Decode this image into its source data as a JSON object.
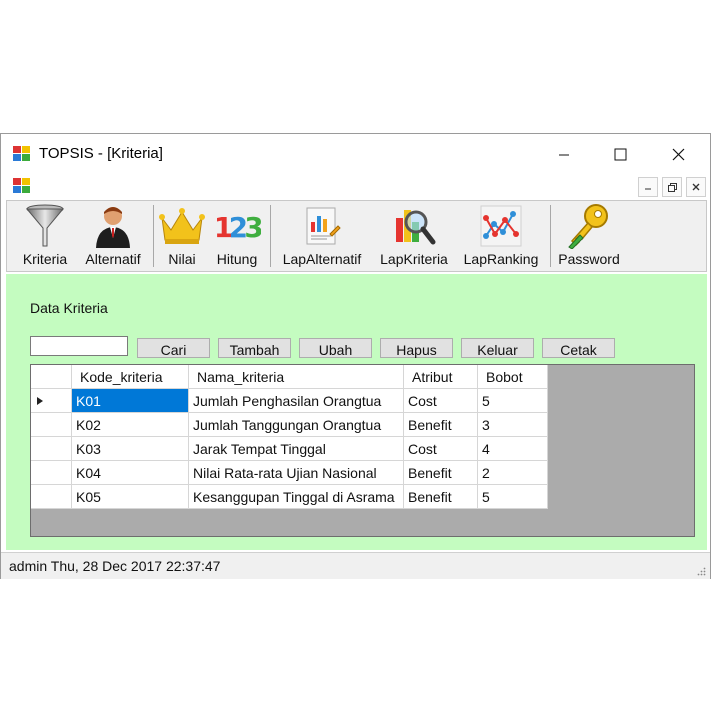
{
  "window": {
    "title": "TOPSIS - [Kriteria]"
  },
  "toolbar": {
    "items": [
      {
        "label": "Kriteria",
        "icon": "funnel-icon"
      },
      {
        "label": "Alternatif",
        "icon": "person-icon"
      },
      {
        "label": "Nilai",
        "icon": "crown-icon"
      },
      {
        "label": "Hitung",
        "icon": "numbers-123-icon"
      },
      {
        "label": "LapAlternatif",
        "icon": "report-chart-icon"
      },
      {
        "label": "LapKriteria",
        "icon": "magnifier-icon"
      },
      {
        "label": "LapRanking",
        "icon": "network-chart-icon"
      },
      {
        "label": "Password",
        "icon": "key-icon"
      }
    ]
  },
  "form": {
    "heading": "Data Kriteria",
    "search_value": "",
    "buttons": [
      "Cari",
      "Tambah",
      "Ubah",
      "Hapus",
      "Keluar",
      "Cetak"
    ]
  },
  "grid": {
    "columns": [
      "Kode_kriteria",
      "Nama_kriteria",
      "Atribut",
      "Bobot"
    ],
    "rows": [
      [
        "K01",
        "Jumlah Penghasilan Orangtua",
        "Cost",
        "5"
      ],
      [
        "K02",
        "Jumlah Tanggungan Orangtua",
        "Benefit",
        "3"
      ],
      [
        "K03",
        "Jarak Tempat Tinggal",
        "Cost",
        "4"
      ],
      [
        "K04",
        "Nilai Rata-rata Ujian Nasional",
        "Benefit",
        "2"
      ],
      [
        "K05",
        "Kesanggupan Tinggal di Asrama",
        "Benefit",
        "5"
      ]
    ],
    "selected_row": 0
  },
  "status": {
    "text": "admin Thu, 28 Dec 2017 22:37:47"
  },
  "colors": {
    "client_bg": "#c4fcc0",
    "selection": "#0078d7"
  }
}
